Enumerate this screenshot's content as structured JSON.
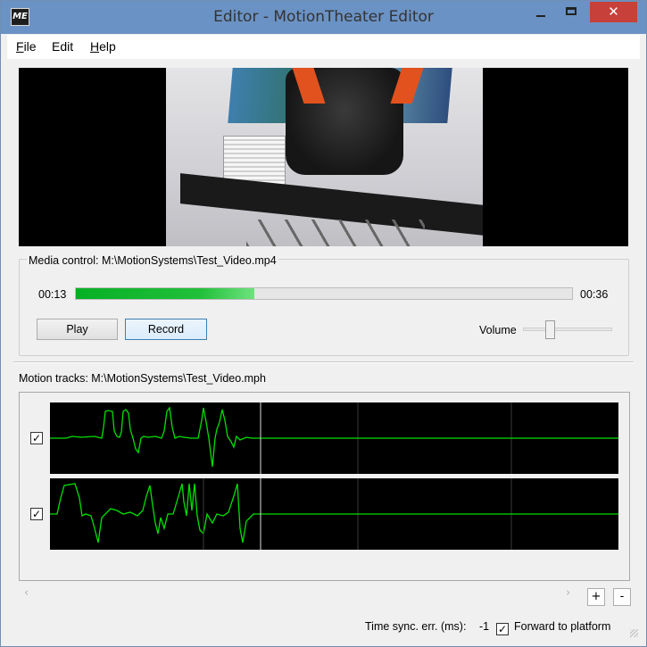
{
  "window": {
    "title": "Editor - MotionTheater Editor",
    "app_icon_text": "ME",
    "close_glyph": "✕"
  },
  "menu": {
    "file": {
      "accel": "F",
      "rest": "ile"
    },
    "edit": {
      "text": "Edit"
    },
    "help": {
      "accel": "H",
      "rest": "elp"
    }
  },
  "media_control": {
    "label": "Media control: M:\\MotionSystems\\Test_Video.mp4",
    "current_time": "00:13",
    "total_time": "00:36",
    "progress_fraction": 0.36,
    "play_label": "Play",
    "record_label": "Record",
    "volume_label": "Volume",
    "volume_fraction": 0.28
  },
  "motion_tracks": {
    "label": "Motion tracks: M:\\MotionSystems\\Test_Video.mph",
    "tracks": [
      {
        "checked": true
      },
      {
        "checked": true
      }
    ],
    "check_glyph": "✓",
    "scroll_left_glyph": "‹",
    "scroll_right_glyph": "›",
    "add_label": "+",
    "remove_label": "-"
  },
  "status": {
    "sync_label": "Time sync. err. (ms):",
    "sync_value": "-1",
    "forward_checked": true,
    "forward_label": "Forward to platform"
  },
  "colors": {
    "titlebar": "#6b92c4",
    "close_button": "#c7403a",
    "progress": "#06b025",
    "track_line": "#00e000",
    "cursor_line": "#e0e0e0",
    "grid": "#3a3a3a"
  }
}
